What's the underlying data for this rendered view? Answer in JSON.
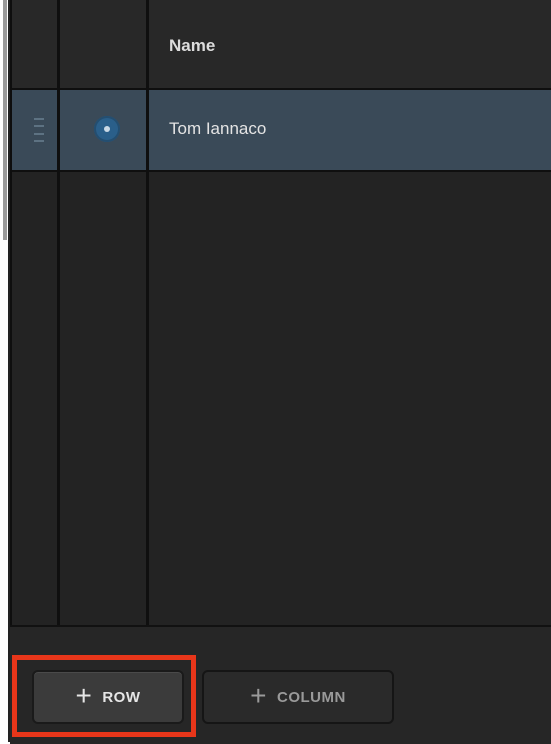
{
  "table": {
    "header": {
      "name_label": "Name"
    },
    "rows": [
      {
        "name": "Tom Iannaco",
        "selected": true
      }
    ]
  },
  "footer": {
    "add_row_label": "ROW",
    "add_column_label": "COLUMN"
  },
  "icons": {
    "add_row": "plus-icon",
    "add_column": "plus-icon",
    "drag": "drag-handle-icon",
    "radio": "radio-icon"
  },
  "colors": {
    "panel_bg": "#222222",
    "row_selected_bg": "#3a4a58",
    "radio_accent": "#2a5f8a",
    "highlight": "#e8361a"
  }
}
